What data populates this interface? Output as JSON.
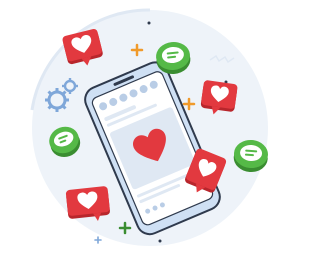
{
  "illustration": {
    "subject": "smartphone-social-media-likes-and-comments",
    "icons": {
      "phone": "smartphone-icon",
      "heart": "heart-icon",
      "like_bubble": "heart-speech-bubble-icon",
      "comment_bubble": "comment-bubble-icon",
      "gear": "gear-icon",
      "sparkle": "plus-sparkle-icon"
    },
    "colors": {
      "background_circle": "#eef3f9",
      "phone_frame": "#cfe0f4",
      "phone_outline": "#2f3a4d",
      "screen": "#ffffff",
      "accent_red": "#e2393f",
      "accent_red_dark": "#b8262c",
      "accent_green": "#55b947",
      "accent_green_dark": "#3a8d31",
      "accent_blue": "#7fa7d9",
      "accent_orange": "#f09a2b"
    }
  }
}
